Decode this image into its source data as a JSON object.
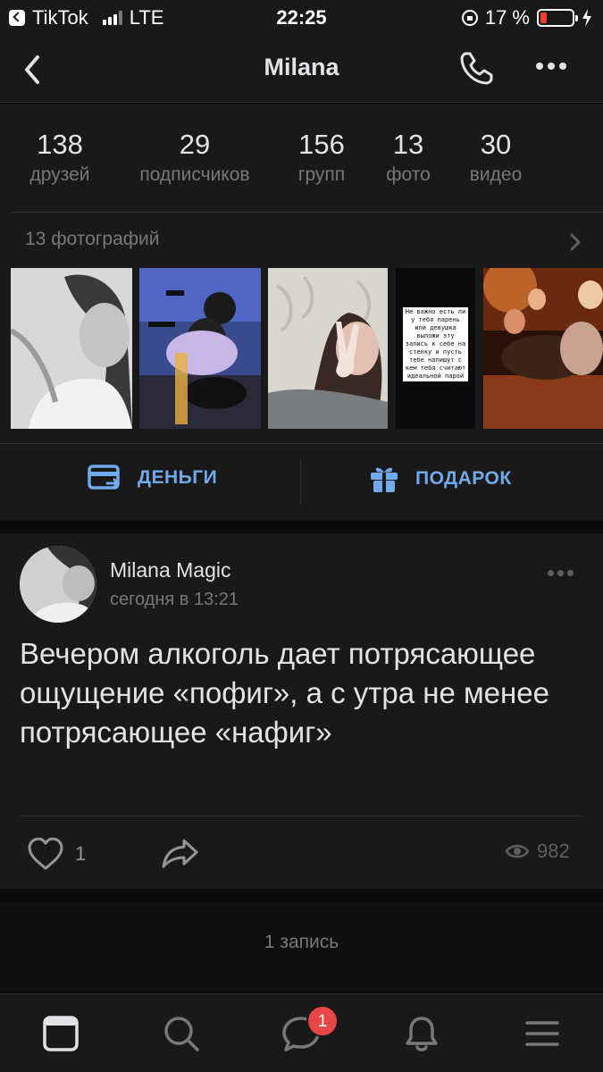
{
  "status_bar": {
    "back_app": "TikTok",
    "network": "LTE",
    "time": "22:25",
    "battery": "17 %",
    "battery_level": 0.17
  },
  "header": {
    "title": "Milana",
    "back_icon": "chevron-left-icon",
    "call_icon": "phone-icon",
    "more_icon": "more-horizontal-icon"
  },
  "counters": [
    {
      "value": "138",
      "label": "друзей"
    },
    {
      "value": "29",
      "label": "подписчиков"
    },
    {
      "value": "156",
      "label": "групп"
    },
    {
      "value": "13",
      "label": "фото"
    },
    {
      "value": "30",
      "label": "видео"
    }
  ],
  "photos": {
    "heading": "13 фотографий",
    "story_text": "Не важно есть ли у тебя парень или девушка выложи эту запись к себе на стенку и пусть тебе напишут с кем тебя считают идеальной парой"
  },
  "actions": {
    "money_label": "ДЕНЬГИ",
    "gift_label": "ПОДАРОК"
  },
  "post": {
    "author": "Milana Magic",
    "date": "сегодня в 13:21",
    "text": "Вечером алкоголь дает потрясающее ощущение «пофиг», а с утра не менее потрясающее «нафиг»",
    "likes": "1",
    "views": "982"
  },
  "posts_count": "1 запись",
  "tabbar": {
    "messages_badge": "1"
  },
  "colors": {
    "accent": "#71aaeb",
    "background": "#19191a",
    "badge": "#e64646"
  }
}
